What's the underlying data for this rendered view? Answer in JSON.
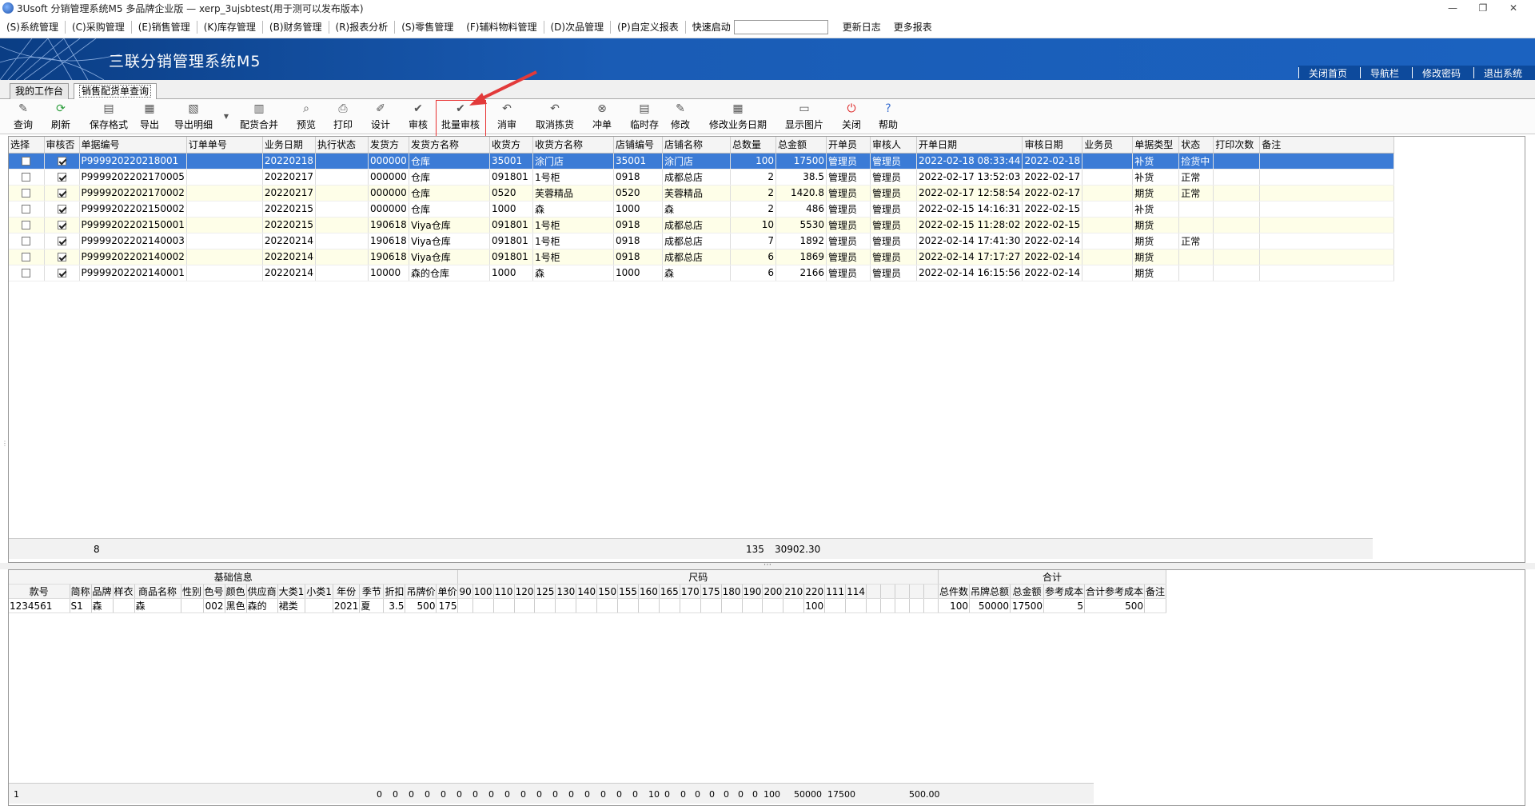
{
  "window": {
    "title": "3Usoft 分销管理系统M5 多品牌企业版 — xerp_3ujsbtest(用于测可以发布版本)",
    "controls": [
      "—",
      "❐",
      "✕"
    ]
  },
  "menu": {
    "items": [
      "(S)系统管理",
      "(C)采购管理",
      "(E)销售管理",
      "(K)库存管理",
      "(B)财务管理",
      "(R)报表分析",
      "(S)零售管理",
      "(F)辅料物料管理",
      "(D)次品管理",
      "(P)自定义报表"
    ],
    "quick_start_label": "快速启动",
    "quick_start_value": "",
    "update_log": "更新日志",
    "more_reports": "更多报表"
  },
  "banner": {
    "system_title": "三联分销管理系统M5",
    "nav": [
      "关闭首页",
      "导航栏",
      "修改密码",
      "退出系统"
    ]
  },
  "tabs": [
    "我的工作台",
    "销售配货单查询"
  ],
  "toolbar": [
    "查询",
    "刷新",
    "保存格式",
    "导出",
    "导出明细",
    "配货合并",
    "预览",
    "打印",
    "设计",
    "审核",
    "批量审核",
    "消审",
    "取消拣货",
    "冲单",
    "临时存",
    "修改",
    "修改业务日期",
    "显示图片",
    "关闭",
    "帮助"
  ],
  "main_grid": {
    "columns": [
      "选择",
      "审核否",
      "单据编号",
      "订单单号",
      "业务日期",
      "执行状态",
      "发货方",
      "发货方名称",
      "收货方",
      "收货方名称",
      "店铺编号",
      "店铺名称",
      "总数量",
      "总金额",
      "开单员",
      "审核人",
      "开单日期",
      "审核日期",
      "业务员",
      "单据类型",
      "状态",
      "打印次数",
      "备注"
    ],
    "rows": [
      [
        "",
        "✓",
        "P999920220218001",
        "",
        "20220218",
        "",
        "000000",
        "仓库",
        "35001",
        "涂门店",
        "35001",
        "涂门店",
        "100",
        "17500",
        "管理员",
        "管理员",
        "2022-02-18 08:33:44",
        "2022-02-18",
        "",
        "补货",
        "捡货中",
        "",
        ""
      ],
      [
        "",
        "✓",
        "P9999202202170005",
        "",
        "20220217",
        "",
        "000000",
        "仓库",
        "091801",
        "1号柜",
        "0918",
        "成都总店",
        "2",
        "38.5",
        "管理员",
        "管理员",
        "2022-02-17 13:52:03",
        "2022-02-17",
        "",
        "补货",
        "正常",
        "",
        ""
      ],
      [
        "",
        "✓",
        "P9999202202170002",
        "",
        "20220217",
        "",
        "000000",
        "仓库",
        "0520",
        "芙蓉精品",
        "0520",
        "芙蓉精品",
        "2",
        "1420.8",
        "管理员",
        "管理员",
        "2022-02-17 12:58:54",
        "2022-02-17",
        "",
        "期货",
        "正常",
        "",
        ""
      ],
      [
        "",
        "✓",
        "P9999202202150002",
        "",
        "20220215",
        "",
        "000000",
        "仓库",
        "1000",
        "森",
        "1000",
        "森",
        "2",
        "486",
        "管理员",
        "管理员",
        "2022-02-15 14:16:31",
        "2022-02-15",
        "",
        "补货",
        "",
        "",
        ""
      ],
      [
        "",
        "✓",
        "P9999202202150001",
        "",
        "20220215",
        "",
        "190618",
        "Viya仓库",
        "091801",
        "1号柜",
        "0918",
        "成都总店",
        "10",
        "5530",
        "管理员",
        "管理员",
        "2022-02-15 11:28:02",
        "2022-02-15",
        "",
        "期货",
        "",
        "",
        ""
      ],
      [
        "",
        "✓",
        "P9999202202140003",
        "",
        "20220214",
        "",
        "190618",
        "Viya仓库",
        "091801",
        "1号柜",
        "0918",
        "成都总店",
        "7",
        "1892",
        "管理员",
        "管理员",
        "2022-02-14 17:41:30",
        "2022-02-14",
        "",
        "期货",
        "正常",
        "",
        ""
      ],
      [
        "",
        "✓",
        "P9999202202140002",
        "",
        "20220214",
        "",
        "190618",
        "Viya仓库",
        "091801",
        "1号柜",
        "0918",
        "成都总店",
        "6",
        "1869",
        "管理员",
        "管理员",
        "2022-02-14 17:17:27",
        "2022-02-14",
        "",
        "期货",
        "",
        "",
        ""
      ],
      [
        "",
        "✓",
        "P9999202202140001",
        "",
        "20220214",
        "",
        "10000",
        "森的仓库",
        "1000",
        "森",
        "1000",
        "森",
        "6",
        "2166",
        "管理员",
        "管理员",
        "2022-02-14 16:15:56",
        "2022-02-14",
        "",
        "期货",
        "",
        "",
        ""
      ]
    ],
    "footer": {
      "count": "8",
      "total_qty": "135",
      "total_amount": "30902.30"
    }
  },
  "detail_grid": {
    "group_basic": "基础信息",
    "group_size": "尺码",
    "group_total": "合计",
    "basic_columns": [
      "款号",
      "简称",
      "品牌",
      "样衣",
      "商品名称",
      "性别",
      "色号",
      "颜色",
      "供应商",
      "大类1",
      "小类1",
      "年份",
      "季节",
      "折扣",
      "吊牌价",
      "单价"
    ],
    "size_columns": [
      "90",
      "100",
      "110",
      "120",
      "125",
      "130",
      "140",
      "150",
      "155",
      "160",
      "165",
      "170",
      "175",
      "180",
      "190",
      "200",
      "210",
      "220",
      "111",
      "114",
      "",
      "",
      "",
      "",
      ""
    ],
    "total_columns": [
      "总件数",
      "吊牌总额",
      "总金额",
      "参考成本",
      "合计参考成本",
      "备注"
    ],
    "row_basic": [
      "1234561",
      "S1",
      "森",
      "",
      "森",
      "",
      "002",
      "黑色",
      "森的",
      "裙类",
      "",
      "2021",
      "夏",
      "3.5",
      "500",
      "175"
    ],
    "row_sizes": [
      "",
      "",
      "",
      "",
      "",
      "",
      "",
      "",
      "",
      "",
      "",
      "",
      "",
      "",
      "",
      "",
      "",
      "100",
      "",
      "",
      "",
      "",
      "",
      "",
      ""
    ],
    "row_totals": [
      "100",
      "50000",
      "17500",
      "5",
      "500",
      ""
    ],
    "footer_count": "1",
    "footer_sizes": [
      "0",
      "0",
      "0",
      "0",
      "0",
      "0",
      "0",
      "0",
      "0",
      "0",
      "0",
      "0",
      "0",
      "0",
      "0",
      "0",
      "0",
      "10",
      "0",
      "0",
      "0",
      "0",
      "0",
      "0",
      "0"
    ],
    "footer_totals": [
      "100",
      "50000",
      "17500",
      "",
      "500.00",
      ""
    ]
  }
}
